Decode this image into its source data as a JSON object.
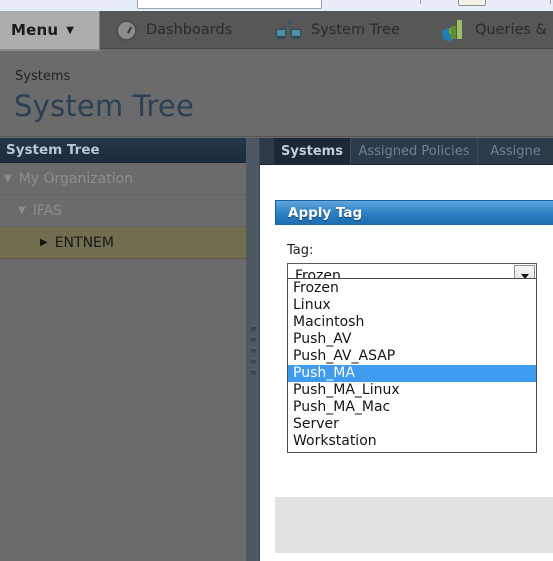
{
  "browser": {
    "address_value": ""
  },
  "topnav": {
    "menu_label": "Menu",
    "menu_caret": "▼",
    "items": [
      {
        "label": "Dashboards",
        "icon": "gauge-icon"
      },
      {
        "label": "System Tree",
        "icon": "system-tree-icon"
      },
      {
        "label": "Queries &",
        "icon": "queries-reports-icon"
      }
    ]
  },
  "page": {
    "breadcrumb": "Systems",
    "title": "System Tree"
  },
  "left_panel": {
    "header": "System Tree",
    "tree": [
      {
        "label": "My Organization",
        "arrow": "▼",
        "level": 0,
        "selected": false
      },
      {
        "label": "IFAS",
        "arrow": "▼",
        "level": 1,
        "selected": false
      },
      {
        "label": "ENTNEM",
        "arrow": "▶",
        "level": 2,
        "selected": true
      }
    ]
  },
  "tabs": [
    {
      "label": "Systems",
      "active": true
    },
    {
      "label": "Assigned Policies",
      "active": false
    },
    {
      "label": "Assigne",
      "active": false
    }
  ],
  "dialog": {
    "title": "Apply Tag",
    "tag_label": "Tag:",
    "selected_value": "Frozen",
    "dropdown_arrow": "▼",
    "options": [
      {
        "label": "Frozen",
        "highlighted": false
      },
      {
        "label": "Linux",
        "highlighted": false
      },
      {
        "label": "Macintosh",
        "highlighted": false
      },
      {
        "label": "Push_AV",
        "highlighted": false
      },
      {
        "label": "Push_AV_ASAP",
        "highlighted": false
      },
      {
        "label": "Push_MA",
        "highlighted": true
      },
      {
        "label": "Push_MA_Linux",
        "highlighted": false
      },
      {
        "label": "Push_MA_Mac",
        "highlighted": false
      },
      {
        "label": "Server",
        "highlighted": false
      },
      {
        "label": "Workstation",
        "highlighted": false
      }
    ]
  },
  "colors": {
    "accent_blue": "#2b7fc4",
    "highlight_blue": "#3e9bf0",
    "panel_header": "#24364a",
    "selected_tree_row": "#706d50",
    "page_bg": "#6b6b6b",
    "title_text": "#2c4055"
  }
}
